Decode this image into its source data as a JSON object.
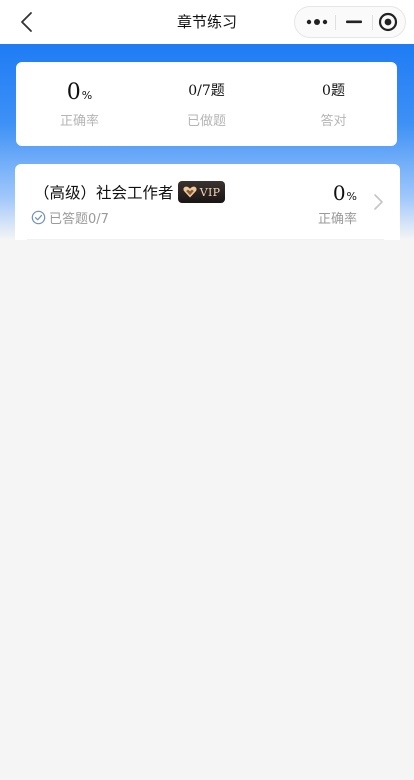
{
  "nav": {
    "title": "章节练习"
  },
  "stats": {
    "accuracy_value": "0",
    "accuracy_unit": "%",
    "accuracy_label": "正确率",
    "done_value": "0/7",
    "done_unit": "题",
    "done_label": "已做题",
    "correct_value": "0",
    "correct_unit": "题",
    "correct_label": "答对"
  },
  "chapter": {
    "title": "（高级）社会工作者",
    "badge": "VIP",
    "answered": "已答题0/7",
    "rate_value": "0",
    "rate_unit": "%",
    "rate_label": "正确率"
  },
  "colors": {
    "accent_blue": "#1f7cf5",
    "page_bg": "#f5f5f5",
    "vip_bg": "#1a1514",
    "vip_text": "#f2d6b0",
    "muted_text": "#b5b5b5"
  },
  "icons": {
    "back": "chevron-left-icon",
    "more": "more-dots-icon",
    "minimize": "minimize-icon",
    "close": "target-circle-icon",
    "vip": "heart-gem-icon",
    "answered": "check-circle-icon",
    "arrow": "chevron-right-icon"
  }
}
